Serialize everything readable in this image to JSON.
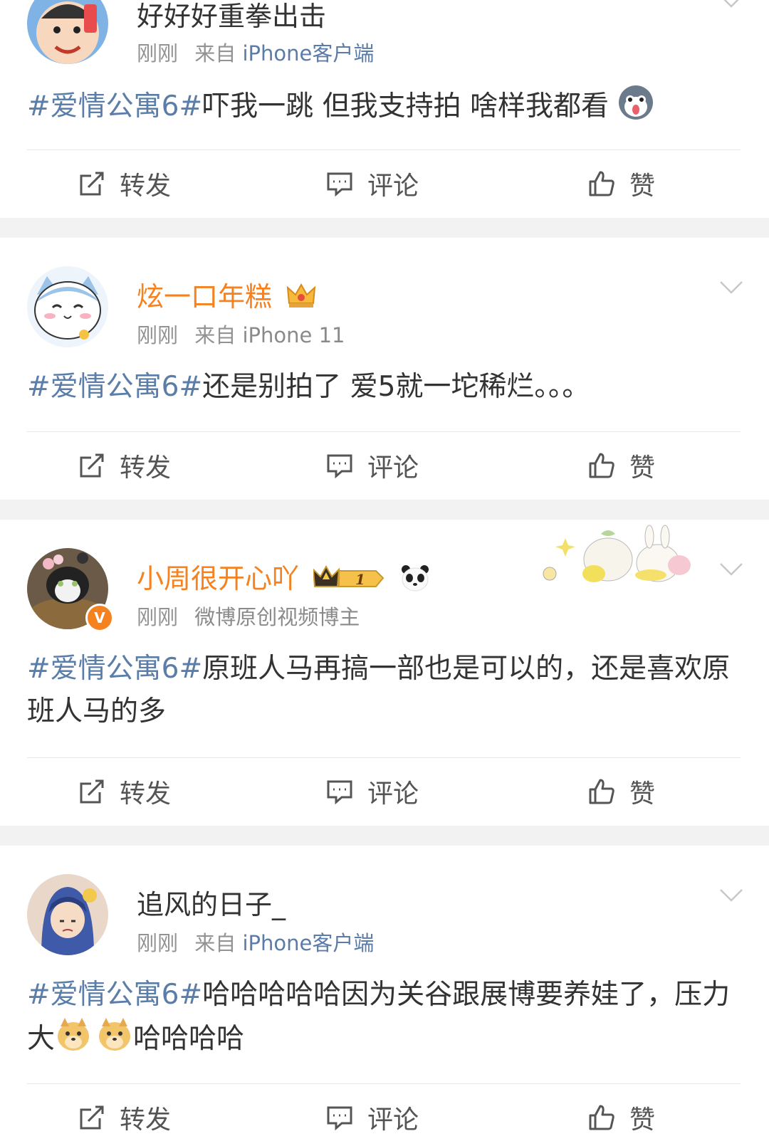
{
  "posts": [
    {
      "username": "好好好重拳出击",
      "time": "刚刚",
      "source": "来自",
      "source_name": "iPhone客户端",
      "hashtag": "#爱情公寓6#",
      "text": "吓我一跳 但我支持拍 啥样我都看",
      "text2": "",
      "text3": ""
    },
    {
      "username": "炫一口年糕",
      "time": "刚刚",
      "source": "来自",
      "source_name": "iPhone 11",
      "hashtag": "#爱情公寓6#",
      "text": "还是别拍了 爱5就一坨稀烂。。。"
    },
    {
      "username": "小周很开心吖",
      "time": "刚刚",
      "source_name": "微博原创视频博主",
      "hashtag": "#爱情公寓6#",
      "text": "原班人马再搞一部也是可以的，还是喜欢原班人马的多",
      "vip_level": "1",
      "verified": "V"
    },
    {
      "username": "追风的日子_",
      "time": "刚刚",
      "source": "来自",
      "source_name": "iPhone客户端",
      "hashtag": "#爱情公寓6#",
      "text": "哈哈哈哈哈因为关谷跟展博要养娃了，压力大",
      "text_after": "哈哈哈哈"
    }
  ],
  "actions": {
    "repost": "转发",
    "comment": "评论",
    "like": "赞"
  },
  "colors": {
    "orange_name": "#f5811f",
    "link_blue": "#5a7ea9",
    "gray_meta": "#939393",
    "separator": "#f2f2f2"
  }
}
